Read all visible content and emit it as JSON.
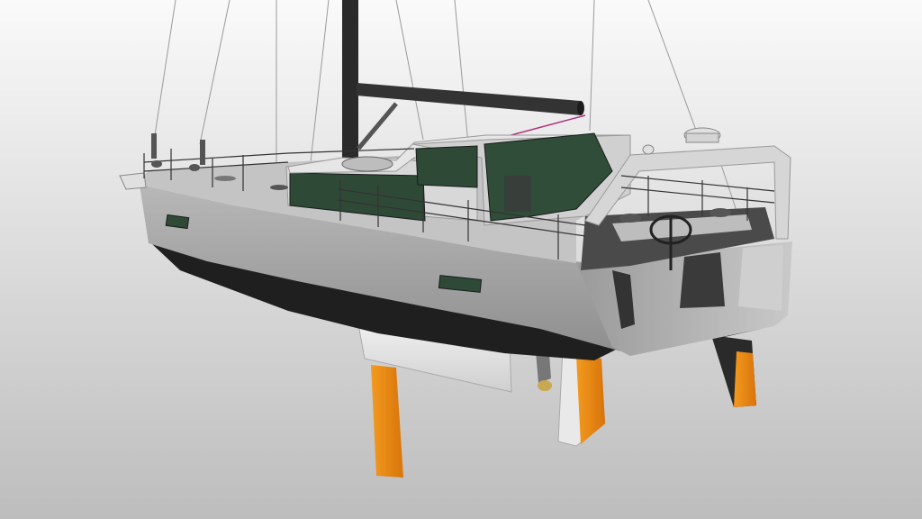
{
  "scene": {
    "subject": "sailboat-render",
    "colors": {
      "background_top": "#fafafa",
      "background_bottom": "#bdbdbd",
      "hull": "#a9a9a9",
      "hull_dark": "#3a3a3a",
      "boot_stripe": "#1f1f1f",
      "deck": "#c8c8c8",
      "glass": "#2e4a36",
      "mast": "#2a2a2a",
      "rudder_orange": "#f08a12",
      "keel": "#e6e6e6",
      "rigging": "#9a9a9a"
    }
  }
}
